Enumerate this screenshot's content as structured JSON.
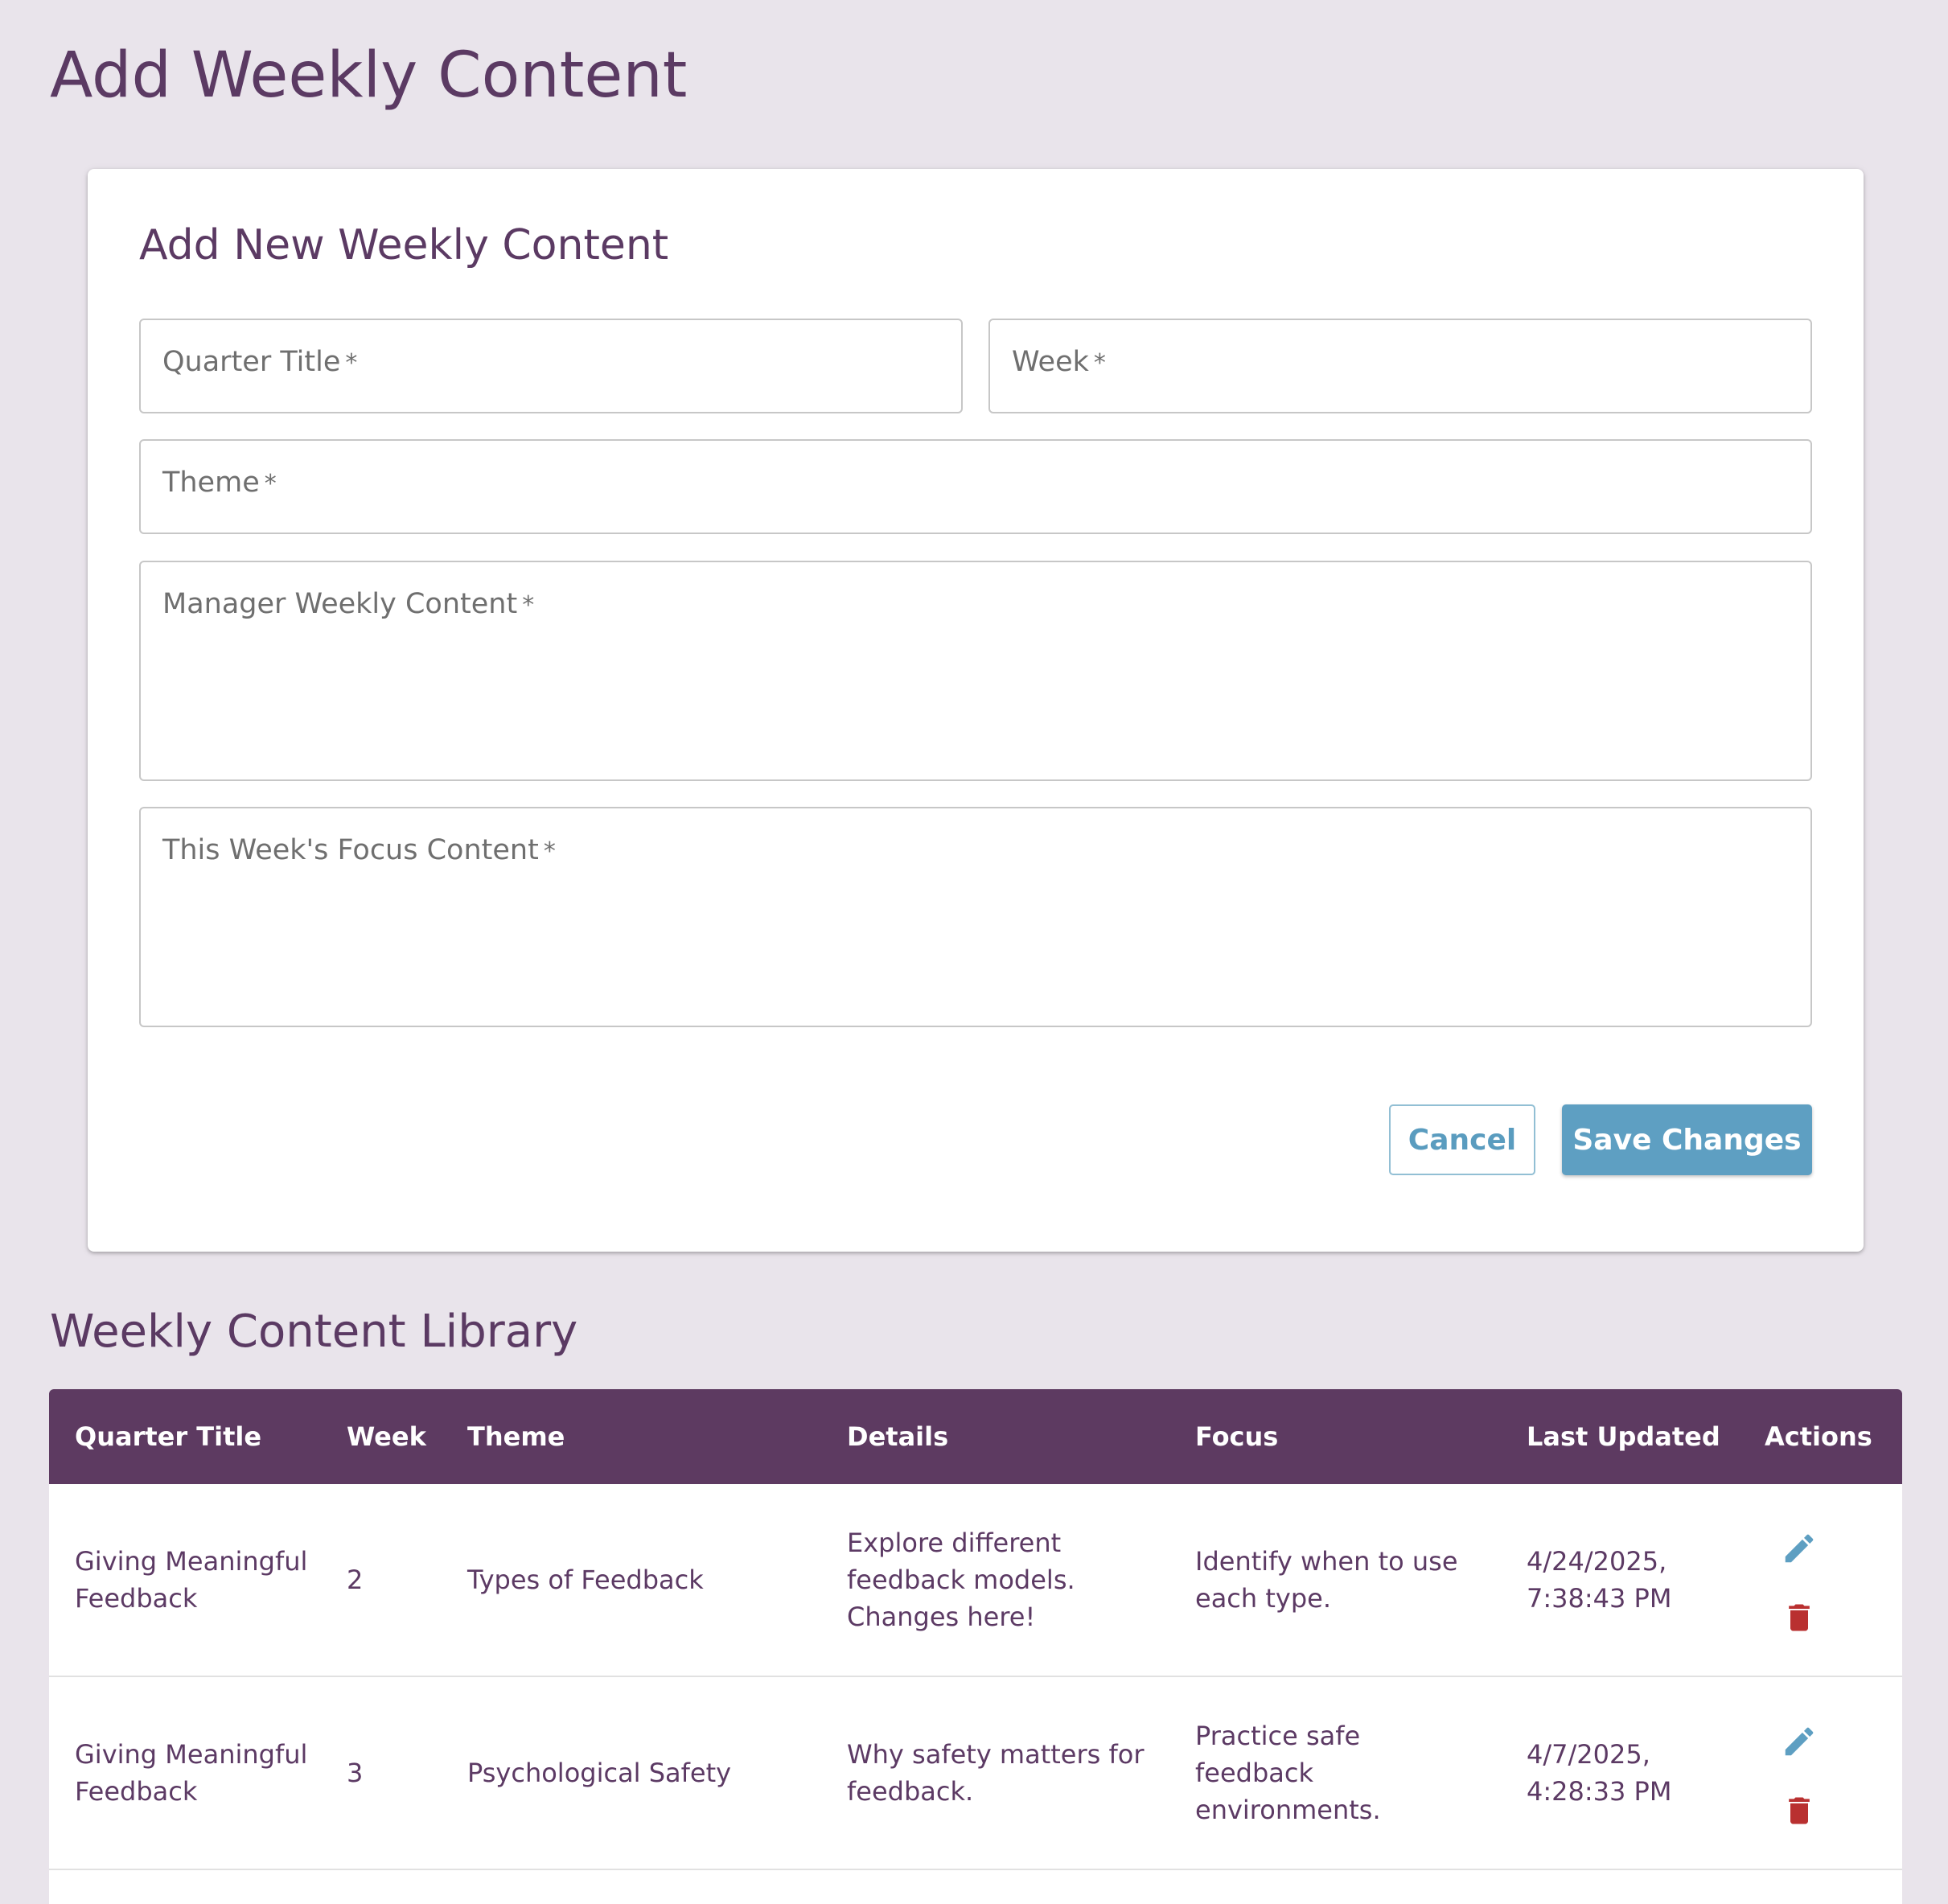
{
  "page": {
    "title": "Add Weekly Content"
  },
  "form": {
    "title": "Add New Weekly Content",
    "fields": {
      "quarter_title": {
        "placeholder": "Quarter Title",
        "required_mark": "*",
        "value": ""
      },
      "week": {
        "placeholder": "Week",
        "required_mark": "*",
        "value": ""
      },
      "theme": {
        "placeholder": "Theme",
        "required_mark": "*",
        "value": ""
      },
      "manager_content": {
        "placeholder": "Manager Weekly Content",
        "required_mark": "*",
        "value": ""
      },
      "focus_content": {
        "placeholder": "This Week's Focus Content",
        "required_mark": "*",
        "value": ""
      }
    },
    "buttons": {
      "cancel": "Cancel",
      "save": "Save Changes"
    }
  },
  "library": {
    "title": "Weekly Content Library",
    "columns": [
      "Quarter Title",
      "Week",
      "Theme",
      "Details",
      "Focus",
      "Last Updated",
      "Actions"
    ],
    "rows": [
      {
        "quarter_title": "Giving Meaningful Feedback",
        "week": "2",
        "theme": "Types of Feedback",
        "details": "Explore different feedback models. Changes here!",
        "focus": "Identify when to use each type.",
        "last_updated": "4/24/2025, 7:38:43 PM",
        "actions": [
          "edit-icon",
          "delete-icon"
        ]
      },
      {
        "quarter_title": "Giving Meaningful Feedback",
        "week": "3",
        "theme": "Psychological Safety",
        "details": "Why safety matters for feedback.",
        "focus": "Practice safe feedback environments.",
        "last_updated": "4/7/2025, 4:28:33 PM",
        "actions": [
          "edit-icon",
          "delete-icon"
        ]
      }
    ]
  },
  "colors": {
    "background": "#e9e4eb",
    "primary_purple": "#5d3a61",
    "accent_blue": "#5e9fc2",
    "delete_red": "#b93030"
  }
}
